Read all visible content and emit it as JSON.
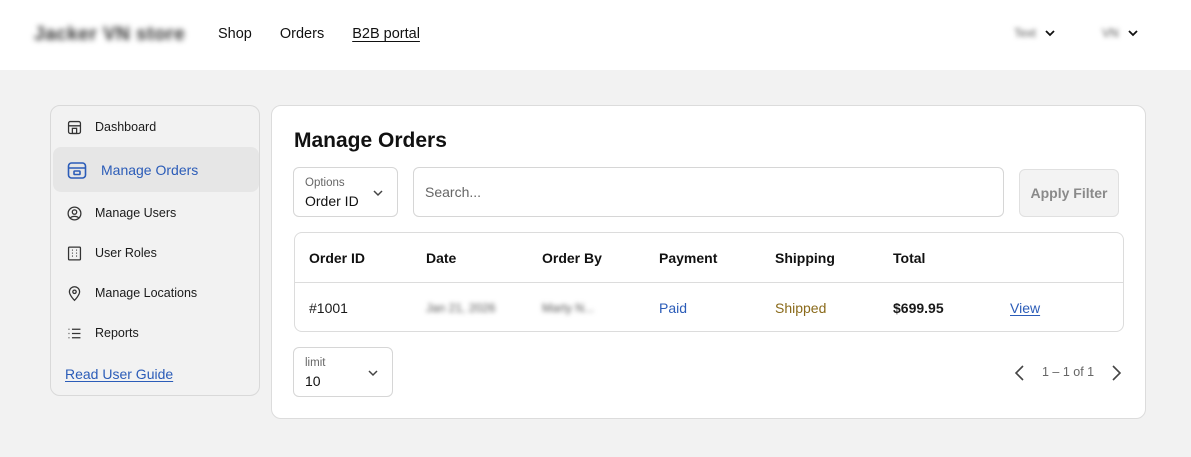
{
  "header": {
    "brand": "Jacker VN store",
    "nav": [
      "Shop",
      "Orders",
      "B2B portal"
    ],
    "active_nav": "B2B portal",
    "language_dropdown": "Text",
    "user_dropdown": "VN"
  },
  "sidebar": {
    "items": [
      {
        "label": "Dashboard",
        "icon": "store-icon"
      },
      {
        "label": "Manage Orders",
        "icon": "box-icon"
      },
      {
        "label": "Manage Users",
        "icon": "user-circle-icon"
      },
      {
        "label": "User Roles",
        "icon": "building-icon"
      },
      {
        "label": "Manage Locations",
        "icon": "location-pin-icon"
      },
      {
        "label": "Reports",
        "icon": "list-icon"
      }
    ],
    "active_item": "Manage Orders",
    "guide_link": "Read User Guide"
  },
  "main": {
    "title": "Manage Orders",
    "filter": {
      "options_label": "Options",
      "options_value": "Order ID",
      "search_placeholder": "Search...",
      "apply_label": "Apply Filter"
    },
    "table": {
      "columns": [
        "Order ID",
        "Date",
        "Order By",
        "Payment",
        "Shipping",
        "Total"
      ],
      "rows": [
        {
          "order_id": "#1001",
          "date": "Jan 21, 2026",
          "order_by": "Marty N...",
          "payment": "Paid",
          "shipping": "Shipped",
          "total": "$699.95",
          "action": "View"
        }
      ]
    },
    "limit": {
      "label": "limit",
      "value": "10"
    },
    "pagination": {
      "text": "1 – 1 of 1"
    }
  },
  "colors": {
    "accent": "#2b5cb8",
    "shipped": "#8a6a1a",
    "page_bg": "#f2f2f2"
  }
}
